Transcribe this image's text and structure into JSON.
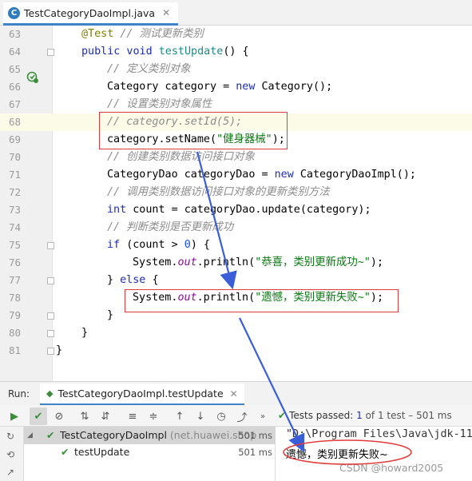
{
  "tab": {
    "file_name": "TestCategoryDaoImpl.java",
    "icon": "C"
  },
  "code_lines": [
    {
      "no": "63",
      "parts": [
        [
          "an",
          "@Test"
        ],
        [
          "",
          " "
        ],
        [
          "cm",
          "// 测试更新类别"
        ]
      ],
      "indent": 1
    },
    {
      "no": "64",
      "parts": [
        [
          "kw",
          "public void "
        ],
        [
          "fn",
          "testUpdate"
        ],
        [
          "",
          "() {"
        ]
      ],
      "indent": 1
    },
    {
      "no": "65",
      "parts": [
        [
          "cm",
          "// 定义类别对象"
        ]
      ],
      "indent": 2
    },
    {
      "no": "66",
      "parts": [
        [
          "",
          "Category category = "
        ],
        [
          "kw",
          "new "
        ],
        [
          "",
          "Category();"
        ]
      ],
      "indent": 2
    },
    {
      "no": "67",
      "parts": [
        [
          "cm",
          "// 设置类别对象属性"
        ]
      ],
      "indent": 2
    },
    {
      "no": "68",
      "parts": [
        [
          "cm",
          "// category.setId(5);"
        ]
      ],
      "indent": 2
    },
    {
      "no": "69",
      "parts": [
        [
          "",
          "category.setName("
        ],
        [
          "st",
          "\"健身器械\""
        ],
        [
          "",
          ");"
        ]
      ],
      "indent": 2
    },
    {
      "no": "70",
      "parts": [
        [
          "cm",
          "// 创建类别数据访问接口对象"
        ]
      ],
      "indent": 2
    },
    {
      "no": "71",
      "parts": [
        [
          "",
          "CategoryDao categoryDao = "
        ],
        [
          "kw",
          "new "
        ],
        [
          "",
          "CategoryDaoImpl();"
        ]
      ],
      "indent": 2
    },
    {
      "no": "72",
      "parts": [
        [
          "cm",
          "// 调用类别数据访问接口对象的更新类别方法"
        ]
      ],
      "indent": 2
    },
    {
      "no": "73",
      "parts": [
        [
          "kw",
          "int "
        ],
        [
          "",
          "count = categoryDao.update(category);"
        ]
      ],
      "indent": 2
    },
    {
      "no": "74",
      "parts": [
        [
          "cm",
          "// 判断类别是否更新成功"
        ]
      ],
      "indent": 2
    },
    {
      "no": "75",
      "parts": [
        [
          "kw",
          "if "
        ],
        [
          "",
          "(count > "
        ],
        [
          "nm",
          "0"
        ],
        [
          "",
          ") {"
        ]
      ],
      "indent": 2
    },
    {
      "no": "76",
      "parts": [
        [
          "",
          "System."
        ],
        [
          "fld",
          "out"
        ],
        [
          "",
          ".println("
        ],
        [
          "st",
          "\"恭喜，类别更新成功~\""
        ],
        [
          "",
          ");"
        ]
      ],
      "indent": 3
    },
    {
      "no": "77",
      "parts": [
        [
          "",
          "} "
        ],
        [
          "kw",
          "else "
        ],
        [
          "",
          "{"
        ]
      ],
      "indent": 2
    },
    {
      "no": "78",
      "parts": [
        [
          "",
          "System."
        ],
        [
          "fld",
          "out"
        ],
        [
          "",
          ".println("
        ],
        [
          "st",
          "\"遗憾，类别更新失败~\""
        ],
        [
          "",
          ");"
        ]
      ],
      "indent": 3
    },
    {
      "no": "79",
      "parts": [
        [
          "",
          "}"
        ]
      ],
      "indent": 2
    },
    {
      "no": "80",
      "parts": [
        [
          "",
          "}"
        ]
      ],
      "indent": 1
    },
    {
      "no": "81",
      "parts": [
        [
          "",
          "}"
        ]
      ],
      "indent": 0
    }
  ],
  "run_panel": {
    "label": "Run:",
    "tab_name": "TestCategoryDaoImpl.testUpdate",
    "status_prefix": "Tests passed:",
    "status_count": "1",
    "status_suffix": "of 1 test – 501 ms",
    "tree": [
      {
        "name": "TestCategoryDaoImpl",
        "package": "(net.huawei.shop",
        "time": "501 ms"
      },
      {
        "name": "testUpdate",
        "package": "",
        "time": "501 ms"
      }
    ],
    "console_path": "\"D:\\Program Files\\Java\\jdk-11",
    "console_output": "遗憾，类别更新失败~"
  },
  "watermark": "CSDN @howard2005",
  "colors": {
    "annotation_red": "#e23b3b",
    "arrow_blue": "#3a5ed8",
    "tab_accent": "#4083c9",
    "pass_green": "#3a8e3a"
  }
}
